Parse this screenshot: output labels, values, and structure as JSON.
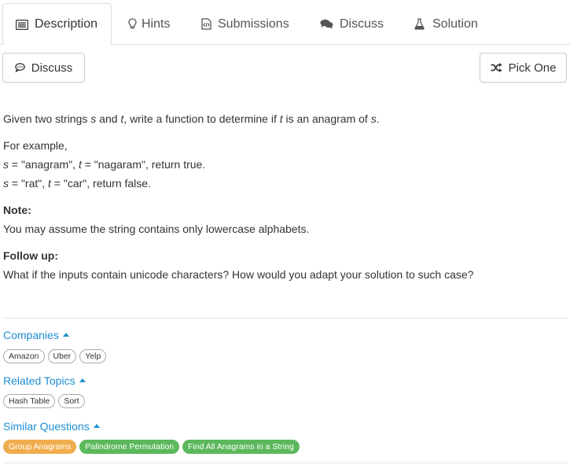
{
  "tabs": [
    {
      "label": "Description",
      "icon": "description-icon",
      "active": true
    },
    {
      "label": "Hints",
      "icon": "lightbulb-icon"
    },
    {
      "label": "Submissions",
      "icon": "code-file-icon"
    },
    {
      "label": "Discuss",
      "icon": "comments-icon"
    },
    {
      "label": "Solution",
      "icon": "flask-icon"
    }
  ],
  "toolbar": {
    "discuss_label": "Discuss",
    "pick_one_label": "Pick One"
  },
  "problem": {
    "line1": {
      "a": "Given two strings ",
      "s": "s",
      "b": " and ",
      "t": "t",
      "c": ", write a function to determine if ",
      "t2": "t",
      "d": " is an anagram of ",
      "s2": "s",
      "e": "."
    },
    "example_intro": "For example,",
    "example1": {
      "s": "s",
      "a": " = \"anagram\", ",
      "t": "t",
      "b": " = \"nagaram\", return true."
    },
    "example2": {
      "s": "s",
      "a": " = \"rat\", ",
      "t": "t",
      "b": " = \"car\", return false."
    },
    "note_heading": "Note:",
    "note_text": "You may assume the string contains only lowercase alphabets.",
    "followup_heading": "Follow up:",
    "followup_text": "What if the inputs contain unicode characters? How would you adapt your solution to such case?"
  },
  "companies": {
    "title": "Companies",
    "tags": [
      "Amazon",
      "Uber",
      "Yelp"
    ]
  },
  "related_topics": {
    "title": "Related Topics",
    "tags": [
      "Hash Table",
      "Sort"
    ]
  },
  "similar_questions": {
    "title": "Similar Questions",
    "items": [
      {
        "label": "Group Anagrams",
        "color": "#f0ad4e"
      },
      {
        "label": "Palindrome Permutation",
        "color": "#5cb85c"
      },
      {
        "label": "Find All Anagrams in a String",
        "color": "#5cb85c"
      }
    ]
  },
  "colors": {
    "link": "#1e8fd1",
    "medium": "#f0ad4e",
    "easy": "#5cb85c"
  }
}
